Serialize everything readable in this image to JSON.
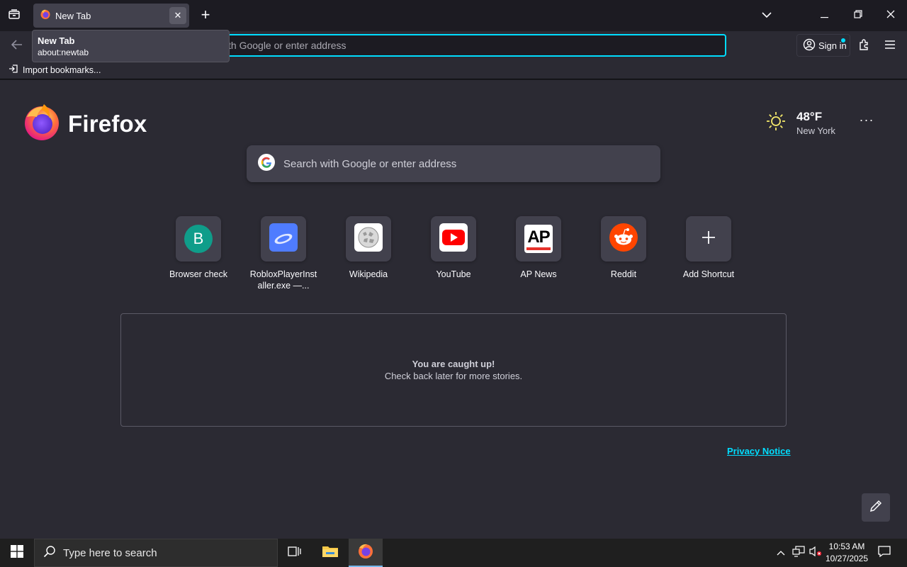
{
  "browser": {
    "tab": {
      "label": "New Tab"
    },
    "tooltip": {
      "title": "New Tab",
      "url": "about:newtab"
    },
    "urlbar": {
      "placeholder": "Search with Google or enter address",
      "visible_text": "th Google or enter address"
    },
    "signin_label": "Sign in",
    "bookmarks": {
      "import_label": "Import bookmarks..."
    }
  },
  "newtab": {
    "brand": "Firefox",
    "weather": {
      "temp": "48°F",
      "location": "New York"
    },
    "search_placeholder": "Search with Google or enter address",
    "shortcuts": [
      {
        "label": "Browser check",
        "letter": "B",
        "color": "#0f9d8a"
      },
      {
        "label": "RobloxPlayerInst aller.exe —...",
        "color": "#4f7cff"
      },
      {
        "label": "Wikipedia"
      },
      {
        "label": "YouTube",
        "color": "#ff0000"
      },
      {
        "label": "AP News",
        "text": "AP"
      },
      {
        "label": "Reddit",
        "color": "#ff4500"
      },
      {
        "label": "Add Shortcut"
      }
    ],
    "stories": {
      "title": "You are caught up!",
      "subtitle": "Check back later for more stories."
    },
    "privacy_label": "Privacy Notice"
  },
  "taskbar": {
    "search_placeholder": "Type here to search",
    "time": "10:53 AM",
    "date": "10/27/2025"
  },
  "colors": {
    "accent": "#00ddff",
    "bg": "#2b2a33",
    "tile": "#42414d"
  }
}
